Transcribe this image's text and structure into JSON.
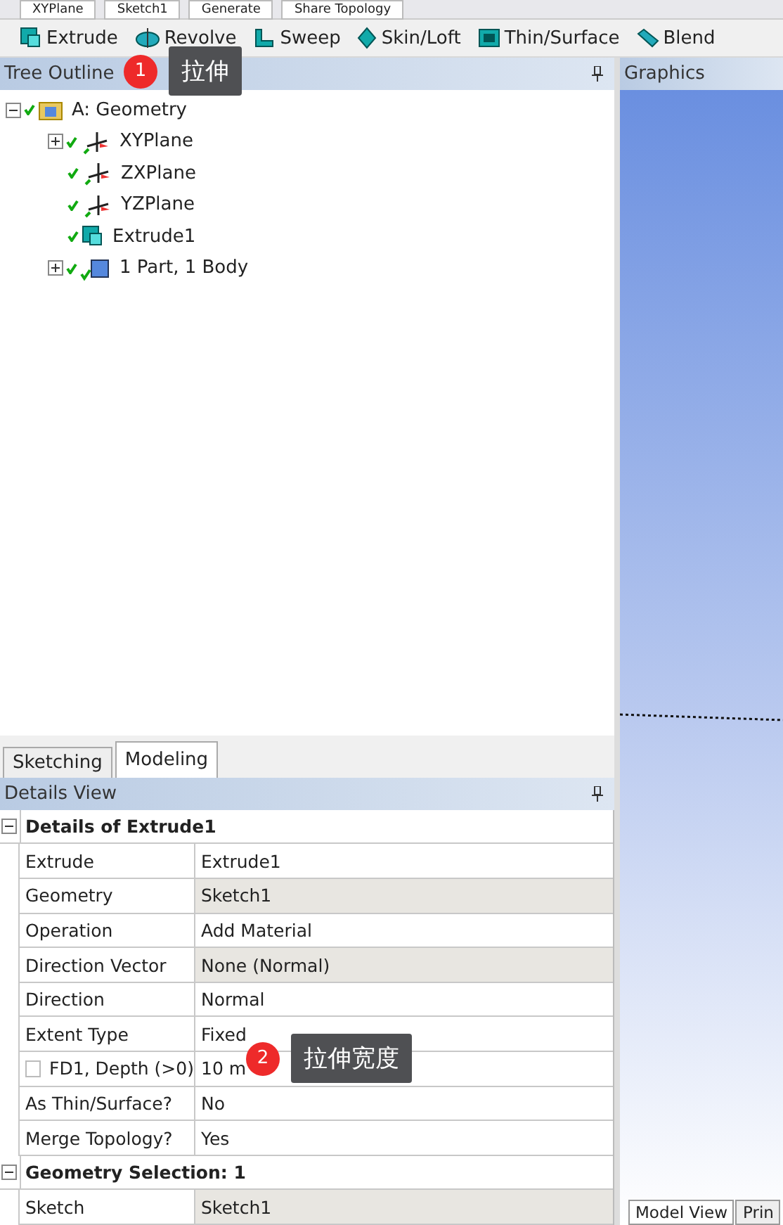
{
  "top_toolbar": {
    "items": [
      "XYPlane",
      "Sketch1",
      "Generate",
      "Share Topology"
    ]
  },
  "feature_toolbar": {
    "items": [
      {
        "label": "Extrude",
        "kind": "extrude"
      },
      {
        "label": "Revolve",
        "kind": "revolve"
      },
      {
        "label": "Sweep",
        "kind": "sweep"
      },
      {
        "label": "Skin/Loft",
        "kind": "loft"
      },
      {
        "label": "Thin/Surface",
        "kind": "thin"
      },
      {
        "label": "Blend",
        "kind": "blend"
      }
    ]
  },
  "tree_outline": {
    "title": "Tree Outline",
    "root": {
      "label": "A: Geometry",
      "expanded": true,
      "children": [
        {
          "label": "XYPlane",
          "kind": "plane",
          "expandable": true
        },
        {
          "label": "ZXPlane",
          "kind": "plane",
          "expandable": false
        },
        {
          "label": "YZPlane",
          "kind": "plane",
          "expandable": false
        },
        {
          "label": "Extrude1",
          "kind": "extrude",
          "expandable": false
        },
        {
          "label": "1 Part, 1 Body",
          "kind": "body",
          "expandable": true
        }
      ]
    }
  },
  "mode_tabs": [
    {
      "label": "Sketching",
      "selected": false
    },
    {
      "label": "Modeling",
      "selected": true
    }
  ],
  "details_view": {
    "title": "Details View",
    "groups": [
      {
        "title": "Details of Extrude1",
        "rows": [
          {
            "name": "Extrude",
            "value": "Extrude1",
            "shaded": false
          },
          {
            "name": "Geometry",
            "value": "Sketch1",
            "shaded": true
          },
          {
            "name": "Operation",
            "value": "Add Material",
            "shaded": false
          },
          {
            "name": "Direction Vector",
            "value": "None (Normal)",
            "shaded": true
          },
          {
            "name": "Direction",
            "value": "Normal",
            "shaded": false
          },
          {
            "name": "Extent Type",
            "value": "Fixed",
            "shaded": false
          },
          {
            "name": "FD1,  Depth (>0)",
            "value": "10 m",
            "shaded": false,
            "checked": false
          },
          {
            "name": "As Thin/Surface?",
            "value": "No",
            "shaded": false
          },
          {
            "name": "Merge Topology?",
            "value": "Yes",
            "shaded": false
          }
        ]
      },
      {
        "title": "Geometry Selection: 1",
        "rows": [
          {
            "name": "Sketch",
            "value": "Sketch1",
            "shaded": true
          }
        ]
      }
    ]
  },
  "graphics": {
    "title": "Graphics",
    "tabs": [
      {
        "label": "Model View",
        "selected": true
      },
      {
        "label": "Prin",
        "selected": false
      }
    ]
  },
  "annotations": [
    {
      "number": "1",
      "text": "拉伸"
    },
    {
      "number": "2",
      "text": "拉伸宽度"
    }
  ]
}
